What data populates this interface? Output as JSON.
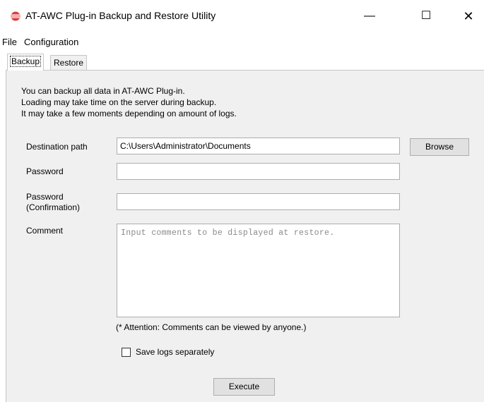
{
  "window": {
    "title": "AT-AWC Plug-in Backup and Restore Utility",
    "icon": "app-logo-icon",
    "minimize": "—",
    "maximize": "☐",
    "close": "✕"
  },
  "menu": [
    "File",
    "Configuration"
  ],
  "tabs": [
    {
      "label": "Backup",
      "active": true
    },
    {
      "label": "Restore",
      "active": false
    }
  ],
  "backup": {
    "info_lines": [
      "You can backup all data in AT-AWC Plug-in.",
      "Loading may take time on the server during backup.",
      "It may take a few moments depending on amount of logs."
    ],
    "destination_label": "Destination path",
    "destination_value": "C:\\Users\\Administrator\\Documents",
    "browse_label": "Browse",
    "password_label": "Password",
    "password_value": "",
    "confirm_label_1": "Password",
    "confirm_label_2": "(Confirmation)",
    "confirm_value": "",
    "comment_label": "Comment",
    "comment_placeholder": "Input comments to be displayed at restore.",
    "attention": "(* Attention: Comments can be viewed by anyone.)",
    "save_logs_label": "Save logs separately",
    "save_logs_checked": false,
    "execute_label": "Execute"
  },
  "colors": {
    "accent_icon": "#e03a3a",
    "panel_bg": "#f0f0f0",
    "button_bg": "#e1e1e1"
  }
}
